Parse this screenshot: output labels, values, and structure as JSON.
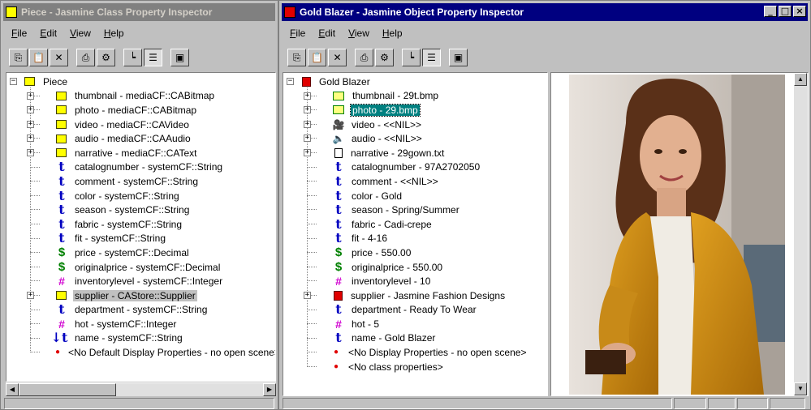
{
  "left_window": {
    "title": "Piece - Jasmine Class Property Inspector",
    "menu": [
      "File",
      "Edit",
      "View",
      "Help"
    ],
    "toolbar": [
      "copy-icon",
      "paste-icon",
      "delete-icon",
      "print-icon",
      "properties-icon",
      "tree-view-icon",
      "list-view-icon",
      "window-icon"
    ],
    "tree": {
      "root": "Piece",
      "items": [
        {
          "label": "thumbnail - mediaCF::CABitmap",
          "icon": "folder",
          "expandable": true
        },
        {
          "label": "photo - mediaCF::CABitmap",
          "icon": "folder",
          "expandable": true
        },
        {
          "label": "video - mediaCF::CAVideo",
          "icon": "folder",
          "expandable": true
        },
        {
          "label": "audio - mediaCF::CAAudio",
          "icon": "folder",
          "expandable": true
        },
        {
          "label": "narrative - mediaCF::CAText",
          "icon": "folder",
          "expandable": true
        },
        {
          "label": "catalognumber - systemCF::String",
          "icon": "t"
        },
        {
          "label": "comment - systemCF::String",
          "icon": "t"
        },
        {
          "label": "color - systemCF::String",
          "icon": "t"
        },
        {
          "label": "season - systemCF::String",
          "icon": "t"
        },
        {
          "label": "fabric - systemCF::String",
          "icon": "t"
        },
        {
          "label": "fit - systemCF::String",
          "icon": "t"
        },
        {
          "label": "price - systemCF::Decimal",
          "icon": "dollar"
        },
        {
          "label": "originalprice - systemCF::Decimal",
          "icon": "dollar"
        },
        {
          "label": "inventorylevel - systemCF::Integer",
          "icon": "hash"
        },
        {
          "label": "supplier - CAStore::Supplier",
          "icon": "folder",
          "expandable": true,
          "highlighted": true
        },
        {
          "label": "department - systemCF::String",
          "icon": "t"
        },
        {
          "label": "hot - systemCF::Integer",
          "icon": "hash"
        },
        {
          "label": "name - systemCF::String",
          "icon": "t-key"
        },
        {
          "label": "<No Default Display Properties - no open scene>",
          "icon": "bullet"
        }
      ]
    }
  },
  "right_window": {
    "title": "Gold Blazer - Jasmine Object Property Inspector",
    "window_buttons": [
      "_",
      "□",
      "×"
    ],
    "menu": [
      "File",
      "Edit",
      "View",
      "Help"
    ],
    "toolbar": [
      "copy-icon",
      "paste-icon",
      "delete-icon",
      "print-icon",
      "properties-icon",
      "tree-view-icon",
      "list-view-icon",
      "window-icon"
    ],
    "tree": {
      "root": "Gold Blazer",
      "items": [
        {
          "label": "thumbnail - 29t.bmp",
          "icon": "img",
          "expandable": true
        },
        {
          "label": "photo - 29.bmp",
          "icon": "img",
          "expandable": true,
          "selected": true
        },
        {
          "label": "video - <<NIL>>",
          "icon": "film",
          "expandable": true
        },
        {
          "label": "audio - <<NIL>>",
          "icon": "speaker",
          "expandable": true
        },
        {
          "label": "narrative - 29gown.txt",
          "icon": "doc",
          "expandable": true
        },
        {
          "label": "catalognumber - 97A2702050",
          "icon": "t"
        },
        {
          "label": "comment - <<NIL>>",
          "icon": "t"
        },
        {
          "label": "color - Gold",
          "icon": "t"
        },
        {
          "label": "season - Spring/Summer",
          "icon": "t"
        },
        {
          "label": "fabric - Cadi-crepe",
          "icon": "t"
        },
        {
          "label": "fit - 4-16",
          "icon": "t"
        },
        {
          "label": "price - 550.00",
          "icon": "dollar"
        },
        {
          "label": "originalprice - 550.00",
          "icon": "dollar"
        },
        {
          "label": "inventorylevel - 10",
          "icon": "hash"
        },
        {
          "label": "supplier - Jasmine Fashion Designs",
          "icon": "redbook",
          "expandable": true
        },
        {
          "label": "department - Ready To Wear",
          "icon": "t"
        },
        {
          "label": "hot - 5",
          "icon": "hash"
        },
        {
          "label": "name - Gold Blazer",
          "icon": "t"
        },
        {
          "label": "<No Display Properties - no open scene>",
          "icon": "bullet"
        },
        {
          "label": "<No class properties>",
          "icon": "bullet"
        }
      ]
    },
    "photo": {
      "description": "photo-viewer-image"
    }
  },
  "colors": {
    "selection": "#008080",
    "title_active": "#000080",
    "title_inactive": "#808080",
    "t_icon": "#0000c0",
    "dollar_icon": "#008000",
    "hash_icon": "#d000d0",
    "bullet": "#e00000"
  }
}
